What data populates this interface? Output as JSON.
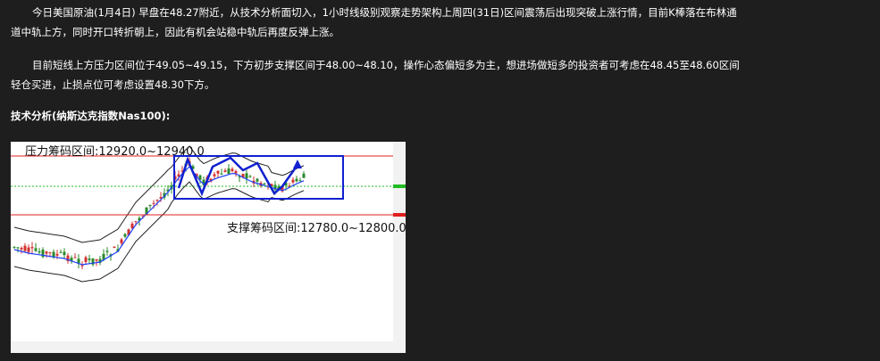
{
  "article": {
    "paragraph1": "今日美国原油(1月4日) 早盘在48.27附近，从技术分析面切入，1小时线级别观察走势架构上周四(31日)区间震荡后出现突破上涨行情，目前K棒落在布林通道中轨上方，同时开口转折朝上，因此有机会站稳中轨后再度反弹上涨。",
    "paragraph2": "目前短线上方压力区间位于49.05~49.15，下方初步支撑区间于48.00~48.10，操作心态偏短多为主，想进场做短多的投资者可考虑在48.45至48.60区间轻仓买进，止损点位可考虑设置48.30下方。",
    "heading": "技术分析(纳斯达克指数Nas100):"
  },
  "chart": {
    "resistance_label": "压力筹码区间:12920.0~12940.0",
    "support_label": "支撑筹码区间:12780.0~12800.0",
    "colors": {
      "candle_up": "#d43030",
      "candle_down": "#2a8a2a",
      "level_line": "#e02020",
      "box": "#1020d0",
      "bands": "#222222",
      "ma": "#2040ff",
      "dotted": "#22bb22"
    }
  }
}
